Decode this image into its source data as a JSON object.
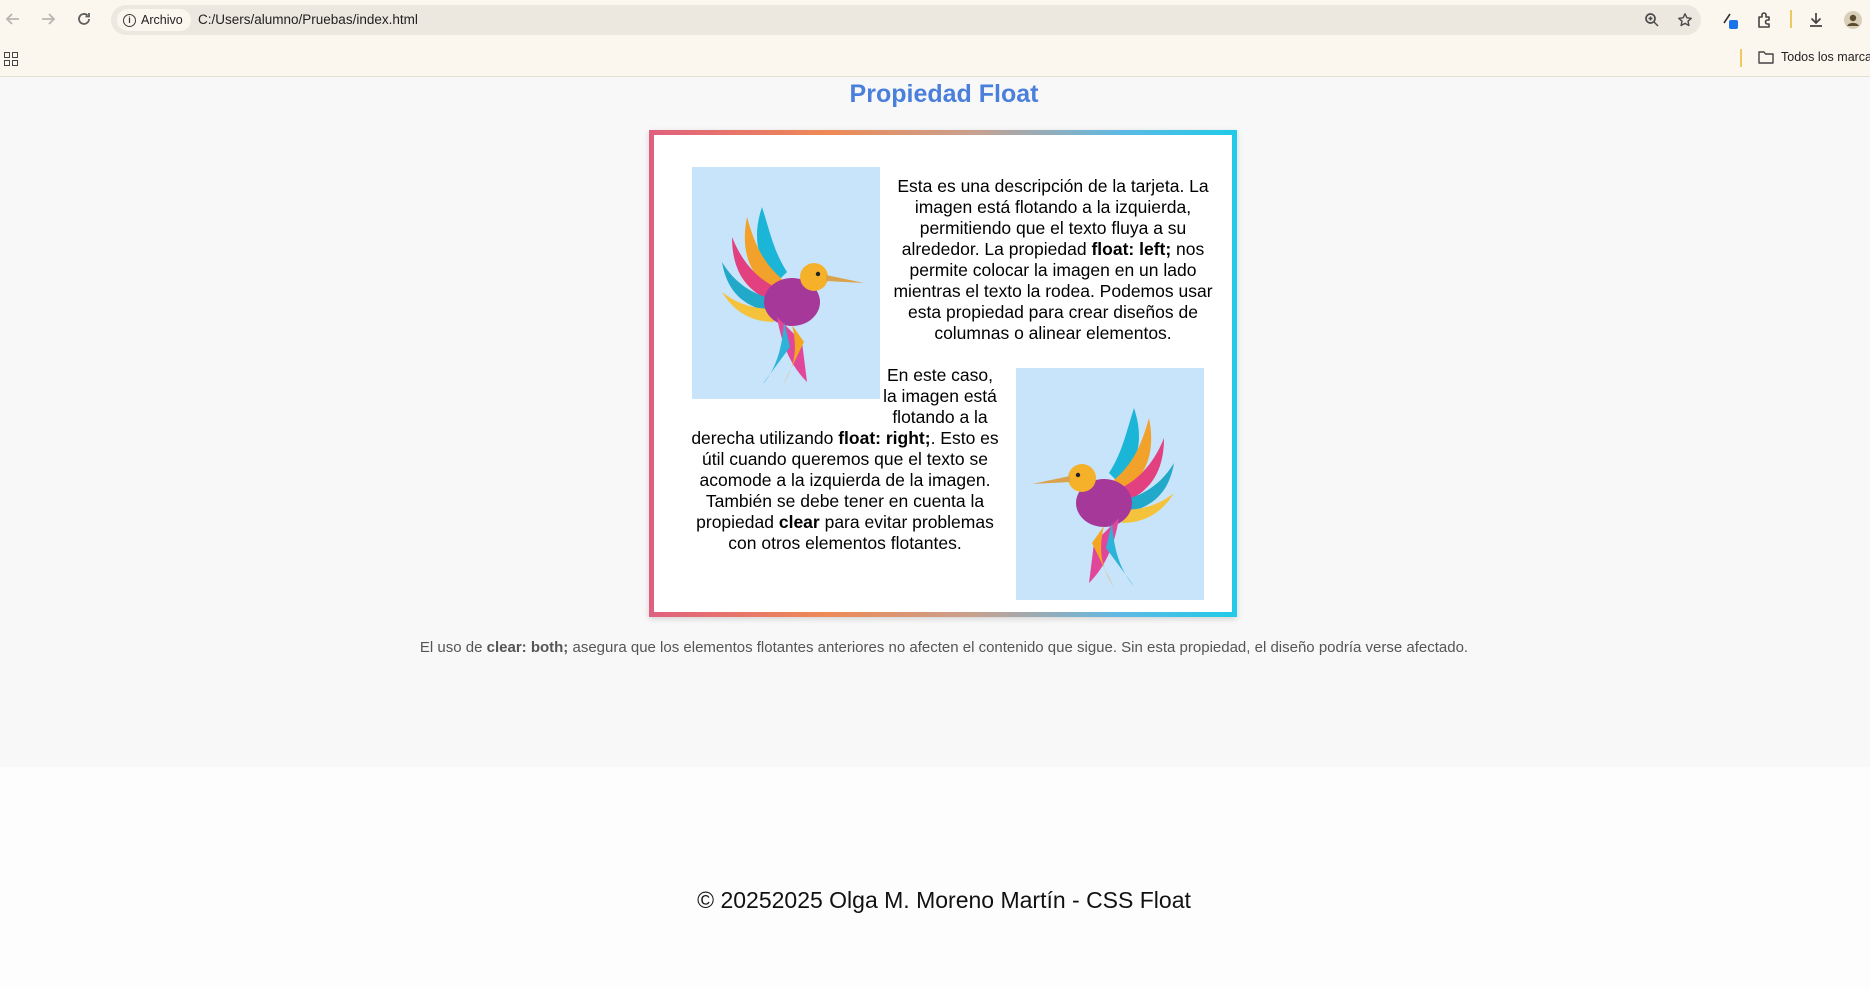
{
  "browser": {
    "site_chip": "Archivo",
    "url": "C:/Users/alumno/Pruebas/index.html",
    "bookmark_folder": "Todos los marcadores"
  },
  "page": {
    "title": "Propiedad Float",
    "card": {
      "p1_before": "Esta es una descripción de la tarjeta. La imagen está flotando a la izquierda, permitiendo que el texto fluya a su alrededor. La propiedad ",
      "p1_bold": "float: left;",
      "p1_after": " nos permite colocar la imagen en un lado mientras el texto la rodea. Podemos usar esta propiedad para crear diseños de columnas o alinear elementos.",
      "p2_line1": "En este caso,",
      "p2_line2": "la imagen está",
      "p2_line3": "flotando a la",
      "p2_before": "derecha utilizando ",
      "p2_bold1": "float: right;",
      "p2_middle": ". Esto es útil cuando queremos que el texto se acomode a la izquierda de la imagen. También se debe tener en cuenta la propiedad ",
      "p2_bold2": "clear",
      "p2_after": " para evitar problemas con otros elementos flotantes."
    },
    "note_before": "El uso de ",
    "note_bold": "clear: both;",
    "note_after": " asegura que los elementos flotantes anteriores no afecten el contenido que sigue. Sin esta propiedad, el diseño podría verse afectado.",
    "footer": "© 20252025 Olga M. Moreno Martín - CSS Float"
  },
  "colors": {
    "title": "#4a7fdc",
    "image_bg": "#c7e4fb",
    "border_gradient": [
      "#e0607f",
      "#ee8a55",
      "#5fb9e4",
      "#1ecbe8"
    ]
  }
}
